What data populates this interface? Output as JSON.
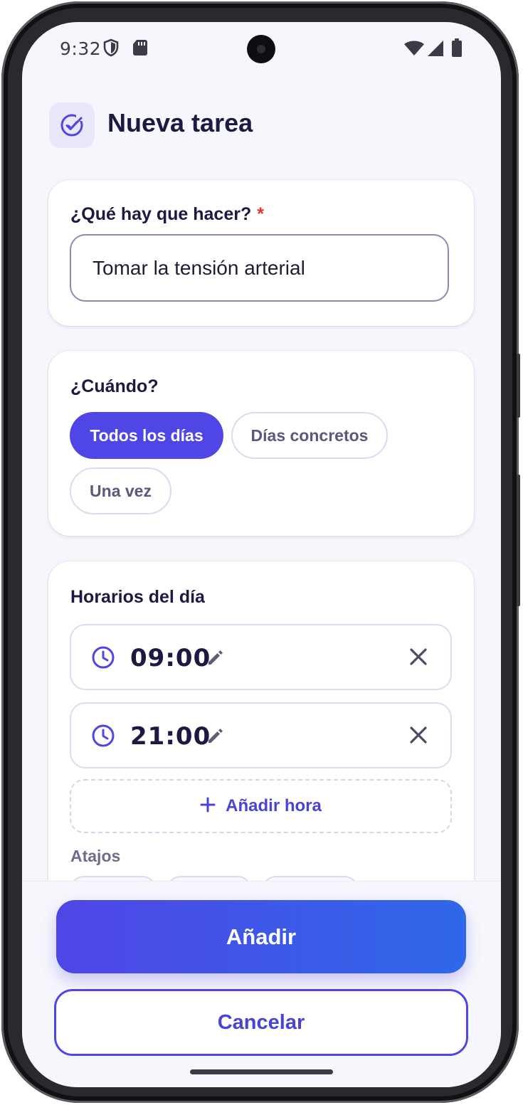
{
  "status_bar": {
    "time": "9:32",
    "icons": [
      "shield-icon",
      "sd-card-icon",
      "wifi-icon",
      "cell-signal-icon",
      "battery-icon"
    ]
  },
  "header": {
    "title": "Nueva tarea",
    "icon": "check-circle-icon"
  },
  "task_card": {
    "label": "¿Qué hay que hacer?",
    "required_mark": "*",
    "input_value": "Tomar la tensión arterial"
  },
  "when_card": {
    "label": "¿Cuándo?",
    "options": [
      {
        "label": "Todos los días",
        "selected": true
      },
      {
        "label": "Días concretos",
        "selected": false
      },
      {
        "label": "Una vez",
        "selected": false
      }
    ]
  },
  "schedule_card": {
    "label": "Horarios del día",
    "times": [
      {
        "value": "09:00"
      },
      {
        "value": "21:00"
      }
    ],
    "add_time_label": "Añadir hora",
    "shortcuts_label": "Atajos"
  },
  "footer": {
    "add_label": "Añadir",
    "cancel_label": "Cancelar"
  },
  "colors": {
    "accent": "#4f46e5",
    "accent_gradient_end": "#2f68ea",
    "text_dark": "#1c1a42",
    "required": "#e0342f",
    "background": "#f6f7fc"
  }
}
